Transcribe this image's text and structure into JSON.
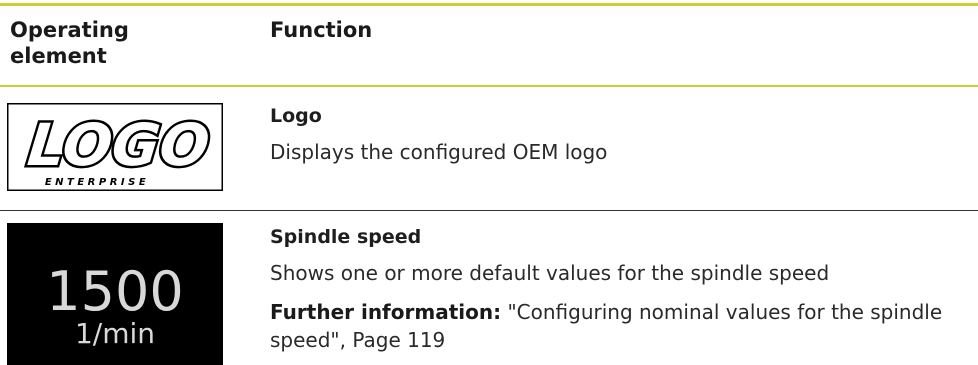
{
  "header": {
    "col1": "Operating element",
    "col2": "Function"
  },
  "rows": [
    {
      "logo_text": "LOGO",
      "logo_subtext": "ENTERPRISE",
      "title": "Logo",
      "description": "Displays the configured OEM logo"
    },
    {
      "tile_value": "1500",
      "tile_unit": "1/min",
      "title": "Spindle speed",
      "description": "Shows one or more default values for the spindle speed",
      "further_label": "Further information:",
      "further_text": "\"Configuring nominal values for the spindle speed\", Page 119"
    }
  ]
}
